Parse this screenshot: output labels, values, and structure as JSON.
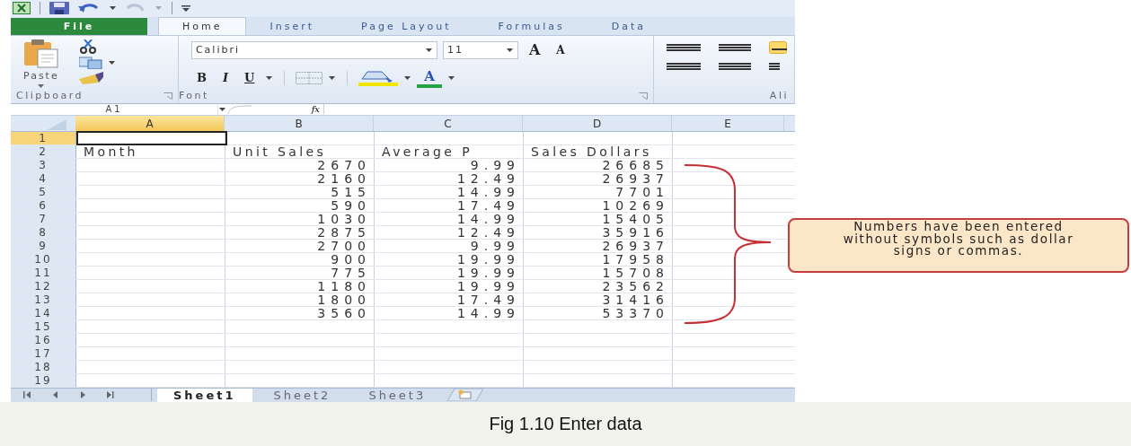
{
  "ribbon_tabs": [
    {
      "label": "File",
      "kind": "file",
      "selected": false
    },
    {
      "label": "Home",
      "kind": "tab",
      "selected": true
    },
    {
      "label": "Insert",
      "kind": "tab",
      "selected": false
    },
    {
      "label": "Page Layout",
      "kind": "tab",
      "selected": false
    },
    {
      "label": "Formulas",
      "kind": "tab",
      "selected": false
    },
    {
      "label": "Data",
      "kind": "tab",
      "selected": false
    }
  ],
  "ribbon": {
    "clipboard": {
      "paste_label": "Paste",
      "group_label": "Clipboard"
    },
    "font": {
      "font_name": "Calibri",
      "font_size": "11",
      "grow_font": "A",
      "shrink_font": "A",
      "bold": "B",
      "italic": "I",
      "underline": "U",
      "font_color": "A",
      "group_label": "Font"
    },
    "alignment": {
      "group_label": "Ali"
    }
  },
  "formula_bar": {
    "name_box": "A1",
    "function_label": "fx"
  },
  "columns": [
    {
      "label": "A",
      "selected": true
    },
    {
      "label": "B",
      "selected": false
    },
    {
      "label": "C",
      "selected": false
    },
    {
      "label": "D",
      "selected": false
    },
    {
      "label": "E",
      "selected": false
    }
  ],
  "rows": [
    {
      "number": "1",
      "kind": "blank",
      "selected": true
    },
    {
      "number": "2",
      "kind": "text",
      "selected": false,
      "a": "Month",
      "b": "Unit Sales",
      "c": "Average P",
      "d": "Sales Dollars"
    },
    {
      "number": "3",
      "kind": "number",
      "selected": false,
      "b": "2670",
      "c": "9.99",
      "d": "26685"
    },
    {
      "number": "4",
      "kind": "number",
      "selected": false,
      "b": "2160",
      "c": "12.49",
      "d": "26937"
    },
    {
      "number": "5",
      "kind": "number",
      "selected": false,
      "b": "515",
      "c": "14.99",
      "d": "7701"
    },
    {
      "number": "6",
      "kind": "number",
      "selected": false,
      "b": "590",
      "c": "17.49",
      "d": "10269"
    },
    {
      "number": "7",
      "kind": "number",
      "selected": false,
      "b": "1030",
      "c": "14.99",
      "d": "15405"
    },
    {
      "number": "8",
      "kind": "number",
      "selected": false,
      "b": "2875",
      "c": "12.49",
      "d": "35916"
    },
    {
      "number": "9",
      "kind": "number",
      "selected": false,
      "b": "2700",
      "c": "9.99",
      "d": "26937"
    },
    {
      "number": "10",
      "kind": "number",
      "selected": false,
      "b": "900",
      "c": "19.99",
      "d": "17958"
    },
    {
      "number": "11",
      "kind": "number",
      "selected": false,
      "b": "775",
      "c": "19.99",
      "d": "15708"
    },
    {
      "number": "12",
      "kind": "number",
      "selected": false,
      "b": "1180",
      "c": "19.99",
      "d": "23562"
    },
    {
      "number": "13",
      "kind": "number",
      "selected": false,
      "b": "1800",
      "c": "17.49",
      "d": "31416"
    },
    {
      "number": "14",
      "kind": "number",
      "selected": false,
      "b": "3560",
      "c": "14.99",
      "d": "53370"
    },
    {
      "number": "15",
      "kind": "blank",
      "selected": false
    },
    {
      "number": "16",
      "kind": "blank",
      "selected": false
    },
    {
      "number": "17",
      "kind": "blank",
      "selected": false
    },
    {
      "number": "18",
      "kind": "blank",
      "selected": false
    },
    {
      "number": "19",
      "kind": "blank",
      "selected": false
    }
  ],
  "sheet_tabs": [
    {
      "label": "Sheet1",
      "selected": true
    },
    {
      "label": "Sheet2",
      "selected": false
    },
    {
      "label": "Sheet3",
      "selected": false
    }
  ],
  "callout": {
    "text": "Numbers have been entered without symbols such as dollar signs or commas."
  },
  "caption": "Fig 1.10 Enter data"
}
